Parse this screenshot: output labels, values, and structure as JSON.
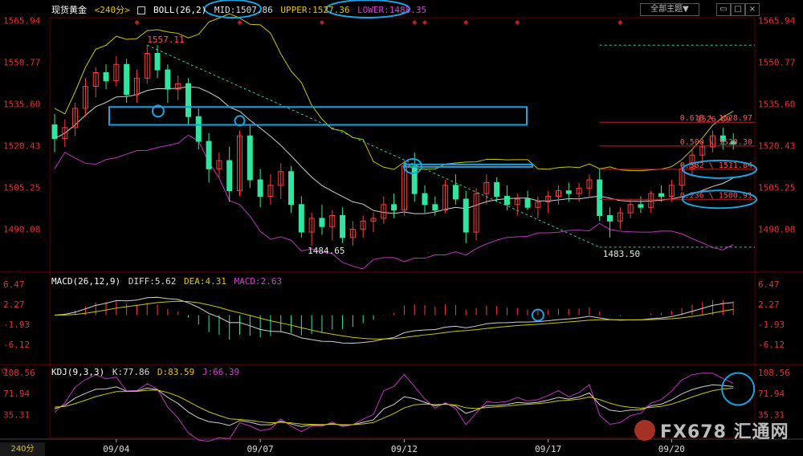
{
  "header": {
    "symbol": "现货黄金",
    "period_tag": "<240分>",
    "boll_label": "BOLL(26,2)",
    "mid_label": "MID:1507.86",
    "upper_label": "UPPER:1527.36",
    "lower_label": "LOWER:1488.35",
    "theme_button": "全部主题▼"
  },
  "macd_header": {
    "name": "MACD(26,12,9)",
    "diff": "DIFF:5.62",
    "dea": "DEA:4.31",
    "macd": "MACD:2.63"
  },
  "kdj_header": {
    "name": "KDJ(9,3,3)",
    "k": "K:77.86",
    "d": "D:83.59",
    "j": "J:66.39"
  },
  "bottom_tag": "240分",
  "watermark": "FX678 汇通网",
  "colors": {
    "up": "#ff3b3b",
    "down": "#2ee6a0",
    "upper_band": "#c8c800",
    "mid_band": "#d0d0d0",
    "lower_band": "#c030c0",
    "highlight": "#1aa3e0",
    "axis_text": "#e03030",
    "fib_text": "#ff5050"
  },
  "chart_data": [
    {
      "type": "candlestick",
      "title": "现货黄金 240分",
      "y_ticks": [
        1565.94,
        1550.77,
        1535.6,
        1520.43,
        1505.25,
        1490.08
      ],
      "ylim": [
        1475,
        1567
      ],
      "x_ticks": [
        "09/04",
        "09/07",
        "09/12",
        "09/17",
        "09/20"
      ],
      "annotations": {
        "high": "1557.11",
        "low1": "1484.65",
        "low2": "1483.50",
        "last": "1526.89",
        "fib_618": "0.618 \\ 1528.97",
        "fib_500": "0.500 \\ 1520.30",
        "fib_382": "0.382 \\ 1511.84",
        "fib_236": "0.236 \\ 1500.91"
      },
      "fib_levels": [
        1528.97,
        1520.3,
        1511.84,
        1500.91
      ],
      "ohlc": [
        [
          1528,
          1532,
          1518,
          1523
        ],
        [
          1523,
          1530,
          1520,
          1527
        ],
        [
          1527,
          1536,
          1524,
          1534
        ],
        [
          1534,
          1545,
          1531,
          1542
        ],
        [
          1542,
          1549,
          1538,
          1547
        ],
        [
          1547,
          1550,
          1541,
          1544
        ],
        [
          1544,
          1553,
          1542,
          1550
        ],
        [
          1550,
          1552,
          1536,
          1539
        ],
        [
          1539,
          1548,
          1536,
          1545
        ],
        [
          1545,
          1557,
          1543,
          1554
        ],
        [
          1554,
          1557,
          1545,
          1548
        ],
        [
          1548,
          1550,
          1536,
          1541
        ],
        [
          1541,
          1546,
          1537,
          1543
        ],
        [
          1543,
          1545,
          1528,
          1531
        ],
        [
          1531,
          1534,
          1519,
          1522
        ],
        [
          1522,
          1525,
          1507,
          1512
        ],
        [
          1512,
          1518,
          1509,
          1515
        ],
        [
          1515,
          1520,
          1500,
          1504
        ],
        [
          1504,
          1526,
          1502,
          1524
        ],
        [
          1524,
          1528,
          1505,
          1508
        ],
        [
          1508,
          1512,
          1498,
          1502
        ],
        [
          1502,
          1510,
          1499,
          1506
        ],
        [
          1506,
          1514,
          1501,
          1511
        ],
        [
          1511,
          1513,
          1496,
          1499
        ],
        [
          1499,
          1502,
          1487,
          1489
        ],
        [
          1489,
          1496,
          1484,
          1494
        ],
        [
          1494,
          1499,
          1488,
          1491
        ],
        [
          1491,
          1497,
          1486,
          1495
        ],
        [
          1495,
          1498,
          1485,
          1487
        ],
        [
          1487,
          1493,
          1484,
          1490
        ],
        [
          1490,
          1495,
          1487,
          1493
        ],
        [
          1493,
          1496,
          1489,
          1494
        ],
        [
          1494,
          1502,
          1492,
          1499
        ],
        [
          1499,
          1503,
          1494,
          1497
        ],
        [
          1497,
          1515,
          1495,
          1513
        ],
        [
          1513,
          1518,
          1500,
          1503
        ],
        [
          1503,
          1506,
          1496,
          1499
        ],
        [
          1499,
          1502,
          1495,
          1497
        ],
        [
          1497,
          1508,
          1496,
          1506
        ],
        [
          1506,
          1510,
          1499,
          1501
        ],
        [
          1501,
          1504,
          1485,
          1489
        ],
        [
          1489,
          1505,
          1486,
          1503
        ],
        [
          1503,
          1510,
          1499,
          1507
        ],
        [
          1507,
          1509,
          1500,
          1502
        ],
        [
          1502,
          1506,
          1497,
          1499
        ],
        [
          1499,
          1503,
          1495,
          1501
        ],
        [
          1501,
          1504,
          1497,
          1498
        ],
        [
          1498,
          1502,
          1494,
          1500
        ],
        [
          1500,
          1504,
          1496,
          1502
        ],
        [
          1502,
          1506,
          1499,
          1504
        ],
        [
          1504,
          1507,
          1500,
          1503
        ],
        [
          1503,
          1507,
          1500,
          1505
        ],
        [
          1505,
          1510,
          1502,
          1508
        ],
        [
          1508,
          1512,
          1493,
          1495
        ],
        [
          1495,
          1498,
          1487,
          1493
        ],
        [
          1493,
          1498,
          1490,
          1496
        ],
        [
          1496,
          1501,
          1494,
          1499
        ],
        [
          1499,
          1502,
          1496,
          1498
        ],
        [
          1498,
          1504,
          1496,
          1503
        ],
        [
          1503,
          1506,
          1500,
          1502
        ],
        [
          1502,
          1508,
          1500,
          1506
        ],
        [
          1506,
          1514,
          1504,
          1512
        ],
        [
          1512,
          1519,
          1510,
          1517
        ],
        [
          1517,
          1522,
          1514,
          1520
        ],
        [
          1520,
          1526,
          1518,
          1524
        ],
        [
          1524,
          1527,
          1519,
          1522
        ],
        [
          1522,
          1525,
          1519,
          1521
        ]
      ]
    },
    {
      "type": "bar",
      "title": "MACD(26,12,9)",
      "y_ticks": [
        6.47,
        2.27,
        -1.93,
        -6.12
      ],
      "ylim": [
        -10,
        8.5
      ]
    },
    {
      "type": "line",
      "title": "KDJ(9,3,3)",
      "y_ticks": [
        108.56,
        71.94,
        35.31
      ],
      "ylim": [
        -5,
        120
      ]
    }
  ]
}
